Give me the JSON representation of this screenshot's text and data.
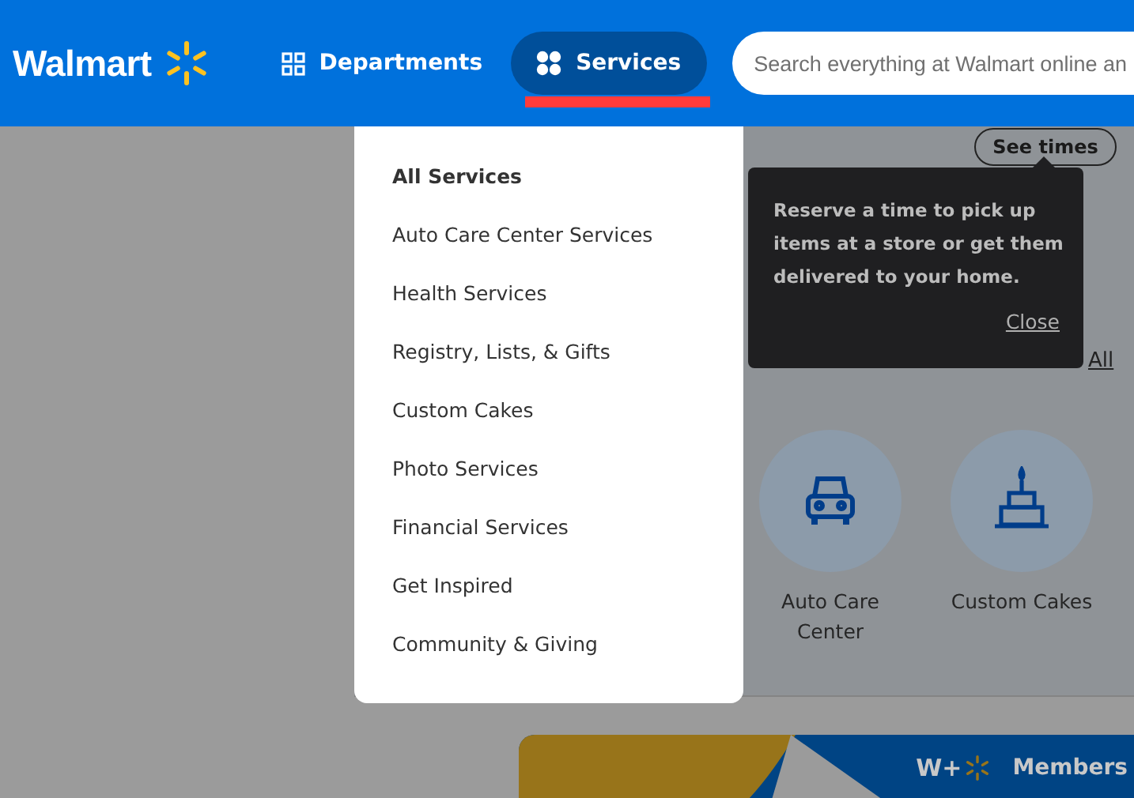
{
  "header": {
    "logo": "Walmart",
    "nav": [
      {
        "label": "Departments",
        "selected": false
      },
      {
        "label": "Services",
        "selected": true
      }
    ],
    "search": {
      "placeholder": "Search everything at Walmart online an"
    }
  },
  "page": {
    "see_times_button": "See times",
    "view_all_link": "All",
    "tiles": [
      {
        "label": "Auto Care Center"
      },
      {
        "label": "Custom Cakes"
      }
    ],
    "banner": {
      "logo": "W+",
      "text": "Members"
    }
  },
  "services_menu": {
    "items": [
      {
        "label": "All Services",
        "kind": "heading"
      },
      {
        "label": "Auto Care Center Services",
        "kind": "link"
      },
      {
        "label": "Health Services",
        "kind": "link"
      },
      {
        "label": "Registry, Lists, & Gifts",
        "kind": "link"
      },
      {
        "label": "Custom Cakes",
        "kind": "link"
      },
      {
        "label": "Photo Services",
        "kind": "link"
      },
      {
        "label": "Financial Services",
        "kind": "link"
      },
      {
        "label": "Get Inspired",
        "kind": "link"
      },
      {
        "label": "Community & Giving",
        "kind": "link"
      }
    ]
  },
  "tooltip": {
    "text": "Reserve a time to pick up items at a store or get them delivered to your home.",
    "close": "Close"
  }
}
